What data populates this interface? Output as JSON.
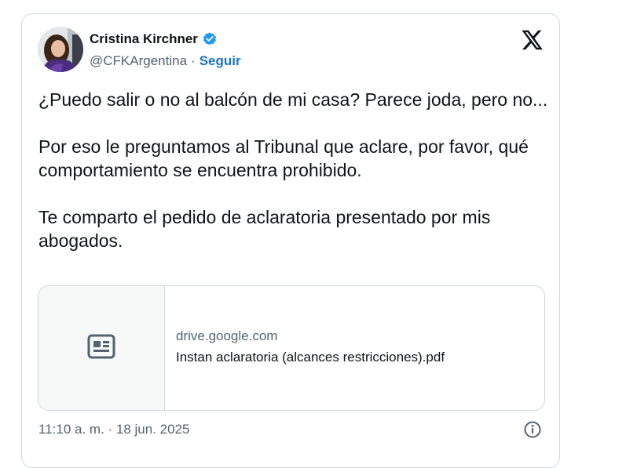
{
  "author": {
    "name": "Cristina Kirchner",
    "handle": "@CFKArgentina",
    "separator": "·",
    "follow_label": "Seguir",
    "verified_badge_icon": "verified-check-icon",
    "badge_color": "#1d9bf0"
  },
  "brand_icon": "x-logo-icon",
  "tweet": {
    "paragraphs": [
      "¿Puedo salir o no al balcón de mi casa? Parece joda, pero no...",
      "Por eso le preguntamos al Tribunal que aclare, por favor, qué comportamiento se encuentra prohibido.",
      "Te comparto el pedido de aclaratoria presentado por mis abogados."
    ]
  },
  "link_card": {
    "thumbnail_icon": "document-icon",
    "domain": "drive.google.com",
    "title": "Instan aclaratoria (alcances restricciones).pdf"
  },
  "footer": {
    "timestamp": "11:10 a. m. · 18 jun. 2025",
    "info_icon": "info-icon"
  },
  "colors": {
    "link_blue": "#1d73c9",
    "secondary_text": "#536471",
    "border": "#cfd9de"
  }
}
